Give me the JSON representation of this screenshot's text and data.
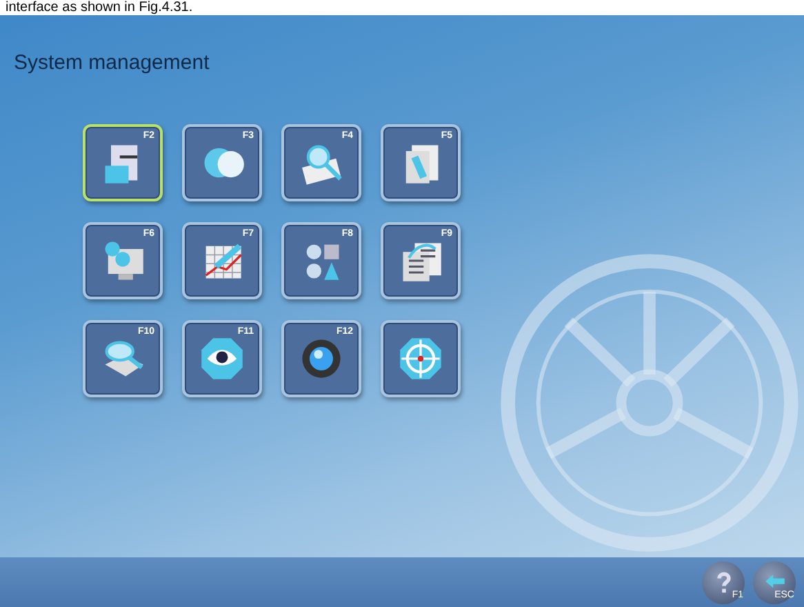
{
  "caption": "interface as shown in Fig.4.31.",
  "screen": {
    "title": "System management",
    "tiles": [
      {
        "key": "F2",
        "kind": "tools",
        "selected": true
      },
      {
        "key": "F3",
        "kind": "heads",
        "selected": false
      },
      {
        "key": "F4",
        "kind": "magnifier",
        "selected": false
      },
      {
        "key": "F5",
        "kind": "document",
        "selected": false
      },
      {
        "key": "F6",
        "kind": "monitor",
        "selected": false
      },
      {
        "key": "F7",
        "kind": "chart",
        "selected": false
      },
      {
        "key": "F8",
        "kind": "language",
        "selected": false
      },
      {
        "key": "F9",
        "kind": "binary",
        "selected": false
      },
      {
        "key": "F10",
        "kind": "scanner",
        "selected": false
      },
      {
        "key": "F11",
        "kind": "eye",
        "selected": false
      },
      {
        "key": "F12",
        "kind": "camera",
        "selected": false
      },
      {
        "kind": "target",
        "selected": false
      }
    ],
    "footer_buttons": [
      {
        "kind": "help",
        "key": "F1"
      },
      {
        "kind": "back",
        "key": "ESC"
      }
    ]
  }
}
